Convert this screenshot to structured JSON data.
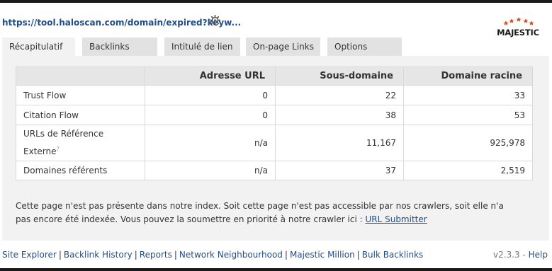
{
  "header": {
    "url_text": "https://tool.haloscan.com/domain/expired?keyw...",
    "logo_text": "MAJESTIC",
    "settings_icon": "gear-icon",
    "logo_star_color": "#e0441f"
  },
  "tabs": [
    {
      "label": "Récapitulatif",
      "active": true
    },
    {
      "label": "Backlinks",
      "active": false
    },
    {
      "label": "Intitulé de lien",
      "active": false
    },
    {
      "label": "On-page Links",
      "active": false
    },
    {
      "label": "Options",
      "active": false
    }
  ],
  "table": {
    "headers": [
      "",
      "Adresse URL",
      "Sous-domaine",
      "Domaine racine"
    ],
    "rows": [
      {
        "label": "Trust Flow",
        "values": [
          "0",
          "22",
          "33"
        ]
      },
      {
        "label": "Citation Flow",
        "values": [
          "0",
          "38",
          "53"
        ]
      },
      {
        "label_line1": "URLs de Référence",
        "label_line2": "Externe",
        "help_mark": "?",
        "values": [
          "n/a",
          "11,167",
          "925,978"
        ]
      },
      {
        "label": "Domaines référents",
        "values": [
          "n/a",
          "37",
          "2,519"
        ]
      }
    ]
  },
  "notice": {
    "text": "Cette page n'est pas présente dans notre index. Soit cette page n'est pas accessible par nos crawlers, soit elle n'a pas encore été indexée. Vous pouvez la soumettre en priorité à notre crawler ici : ",
    "link_label": "URL Submitter"
  },
  "footer": {
    "links": [
      "Site Explorer",
      "Backlink History",
      "Reports",
      "Network Neighbourhood",
      "Majestic Million",
      "Bulk Backlinks"
    ],
    "version": "v2.3.3",
    "help_label": "Help"
  }
}
